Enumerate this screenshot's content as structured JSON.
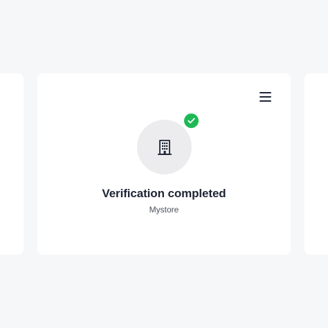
{
  "card": {
    "title": "Verification completed",
    "subtitle": "Mystore",
    "avatar_icon": "building-icon",
    "badge_icon": "check-icon",
    "menu_icon": "hamburger-menu-icon"
  },
  "colors": {
    "background": "#f6f7f9",
    "card": "#ffffff",
    "avatar_bg": "#ececef",
    "success": "#1db954",
    "text_primary": "#1d2433",
    "text_secondary": "#4a505c"
  }
}
